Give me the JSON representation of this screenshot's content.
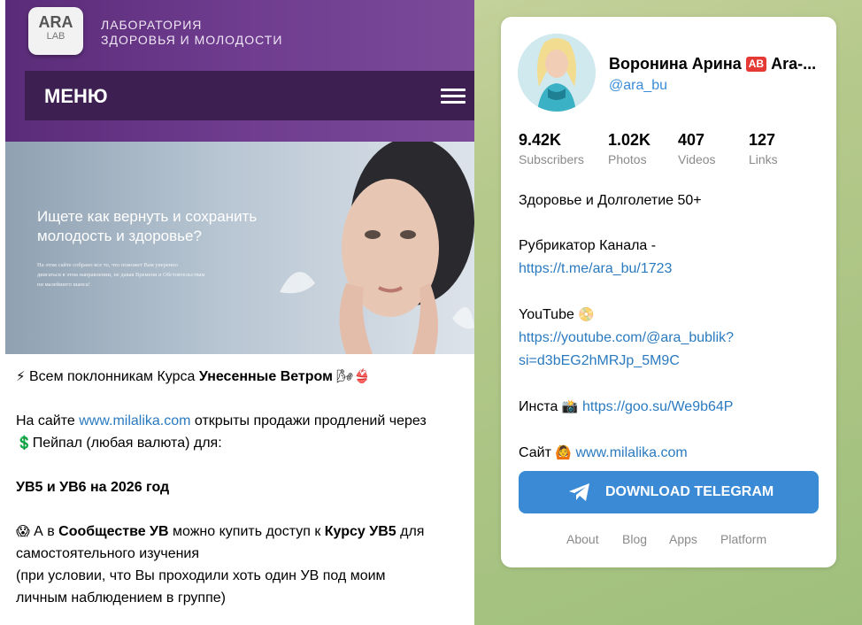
{
  "site": {
    "logo_line1": "ARA",
    "logo_line2": "LAB",
    "brand_line1": "ЛАБОРАТОРИЯ",
    "brand_line2": "ЗДОРОВЬЯ И МОЛОДОСТИ",
    "menu_label": "МЕНЮ",
    "hero_title_line1": "Ищете как вернуть и сохранить",
    "hero_title_line2": "молодость и здоровье?",
    "hero_small_line1": "На этом сайте собрано все то, что поможет Вам уверенно",
    "hero_small_line2": "двигаться в этом направлении, не давая Времени и Обстоятельствам",
    "hero_small_line3": "ни малейшего шанса!"
  },
  "post": {
    "line1_pre": "Всем поклонникам Курса ",
    "line1_bold": "Унесенные Ветром",
    "line2_pre": "На сайте ",
    "line2_link": "www.milalika.com",
    "line2_post": " открыты продажи продлений через",
    "line3": "Пейпал (любая валюта) для:",
    "line4_bold": "УВ5 и УВ6 на 2026 год",
    "line5_pre": " А в ",
    "line5_bold1": "Сообществе УВ",
    "line5_mid": " можно купить доступ к ",
    "line5_bold2": "Курсу УВ5",
    "line5_post": " для",
    "line6": "самостоятельного изучения",
    "line7": "(при условии, что Вы проходили хоть один УВ под моим",
    "line8": "личным наблюдением в группе)"
  },
  "channel": {
    "name": "Воронина Арина",
    "badge": "AB",
    "name_suffix": "Ara-...",
    "handle": "@ara_bu",
    "stats": [
      {
        "value": "9.42K",
        "label": "Subscribers"
      },
      {
        "value": "1.02K",
        "label": "Photos"
      },
      {
        "value": "407",
        "label": "Videos"
      },
      {
        "value": "127",
        "label": "Links"
      }
    ],
    "desc_line1": "Здоровье и Долголетие 50+",
    "rubric_label": "Рубрикатор Канала -",
    "rubric_link": "https://t.me/ara_bu/1723",
    "youtube_label": "YouTube",
    "youtube_link1": "https://youtube.com/@ara_bublik?",
    "youtube_link2": "si=d3bEG2hMRJp_5M9C",
    "insta_label": "Инста",
    "insta_link": "https://goo.su/We9b64P",
    "site_label": "Сайт",
    "site_link": "www.milalika.com",
    "download_label": "DOWNLOAD TELEGRAM",
    "footer": [
      "About",
      "Blog",
      "Apps",
      "Platform"
    ]
  },
  "colors": {
    "accent": "#3a8ad6",
    "link": "#2a7ac0",
    "header_purple": "#5a2c78",
    "menu_purple": "#3e1f52"
  }
}
